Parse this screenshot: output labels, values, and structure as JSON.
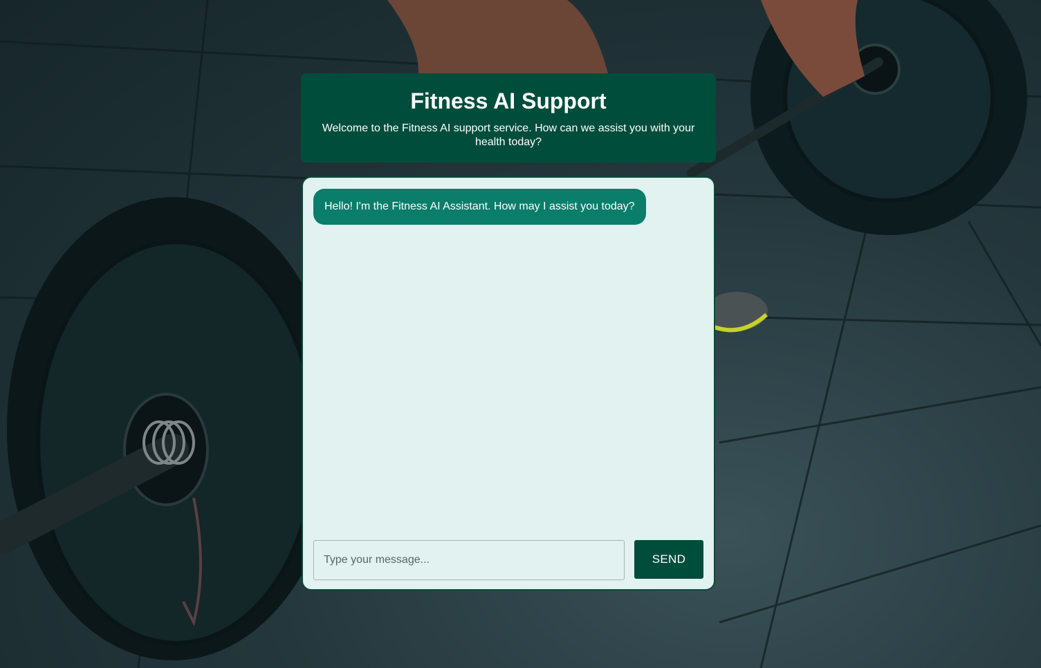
{
  "header": {
    "title": "Fitness AI Support",
    "subtitle": "Welcome to the Fitness AI support service. How can we assist you with your health today?"
  },
  "chat": {
    "messages": [
      {
        "sender": "assistant",
        "text": "Hello! I'm the Fitness AI Assistant. How may I assist you today?"
      }
    ]
  },
  "composer": {
    "placeholder": "Type your message...",
    "value": "",
    "send_label": "SEND"
  },
  "colors": {
    "header_bg": "#014d3c",
    "chat_bg": "#e1f2f0",
    "bubble_bg": "#0a7d6b",
    "button_bg": "#014d3c"
  },
  "background": {
    "icon": "gym-barbell-photo"
  }
}
